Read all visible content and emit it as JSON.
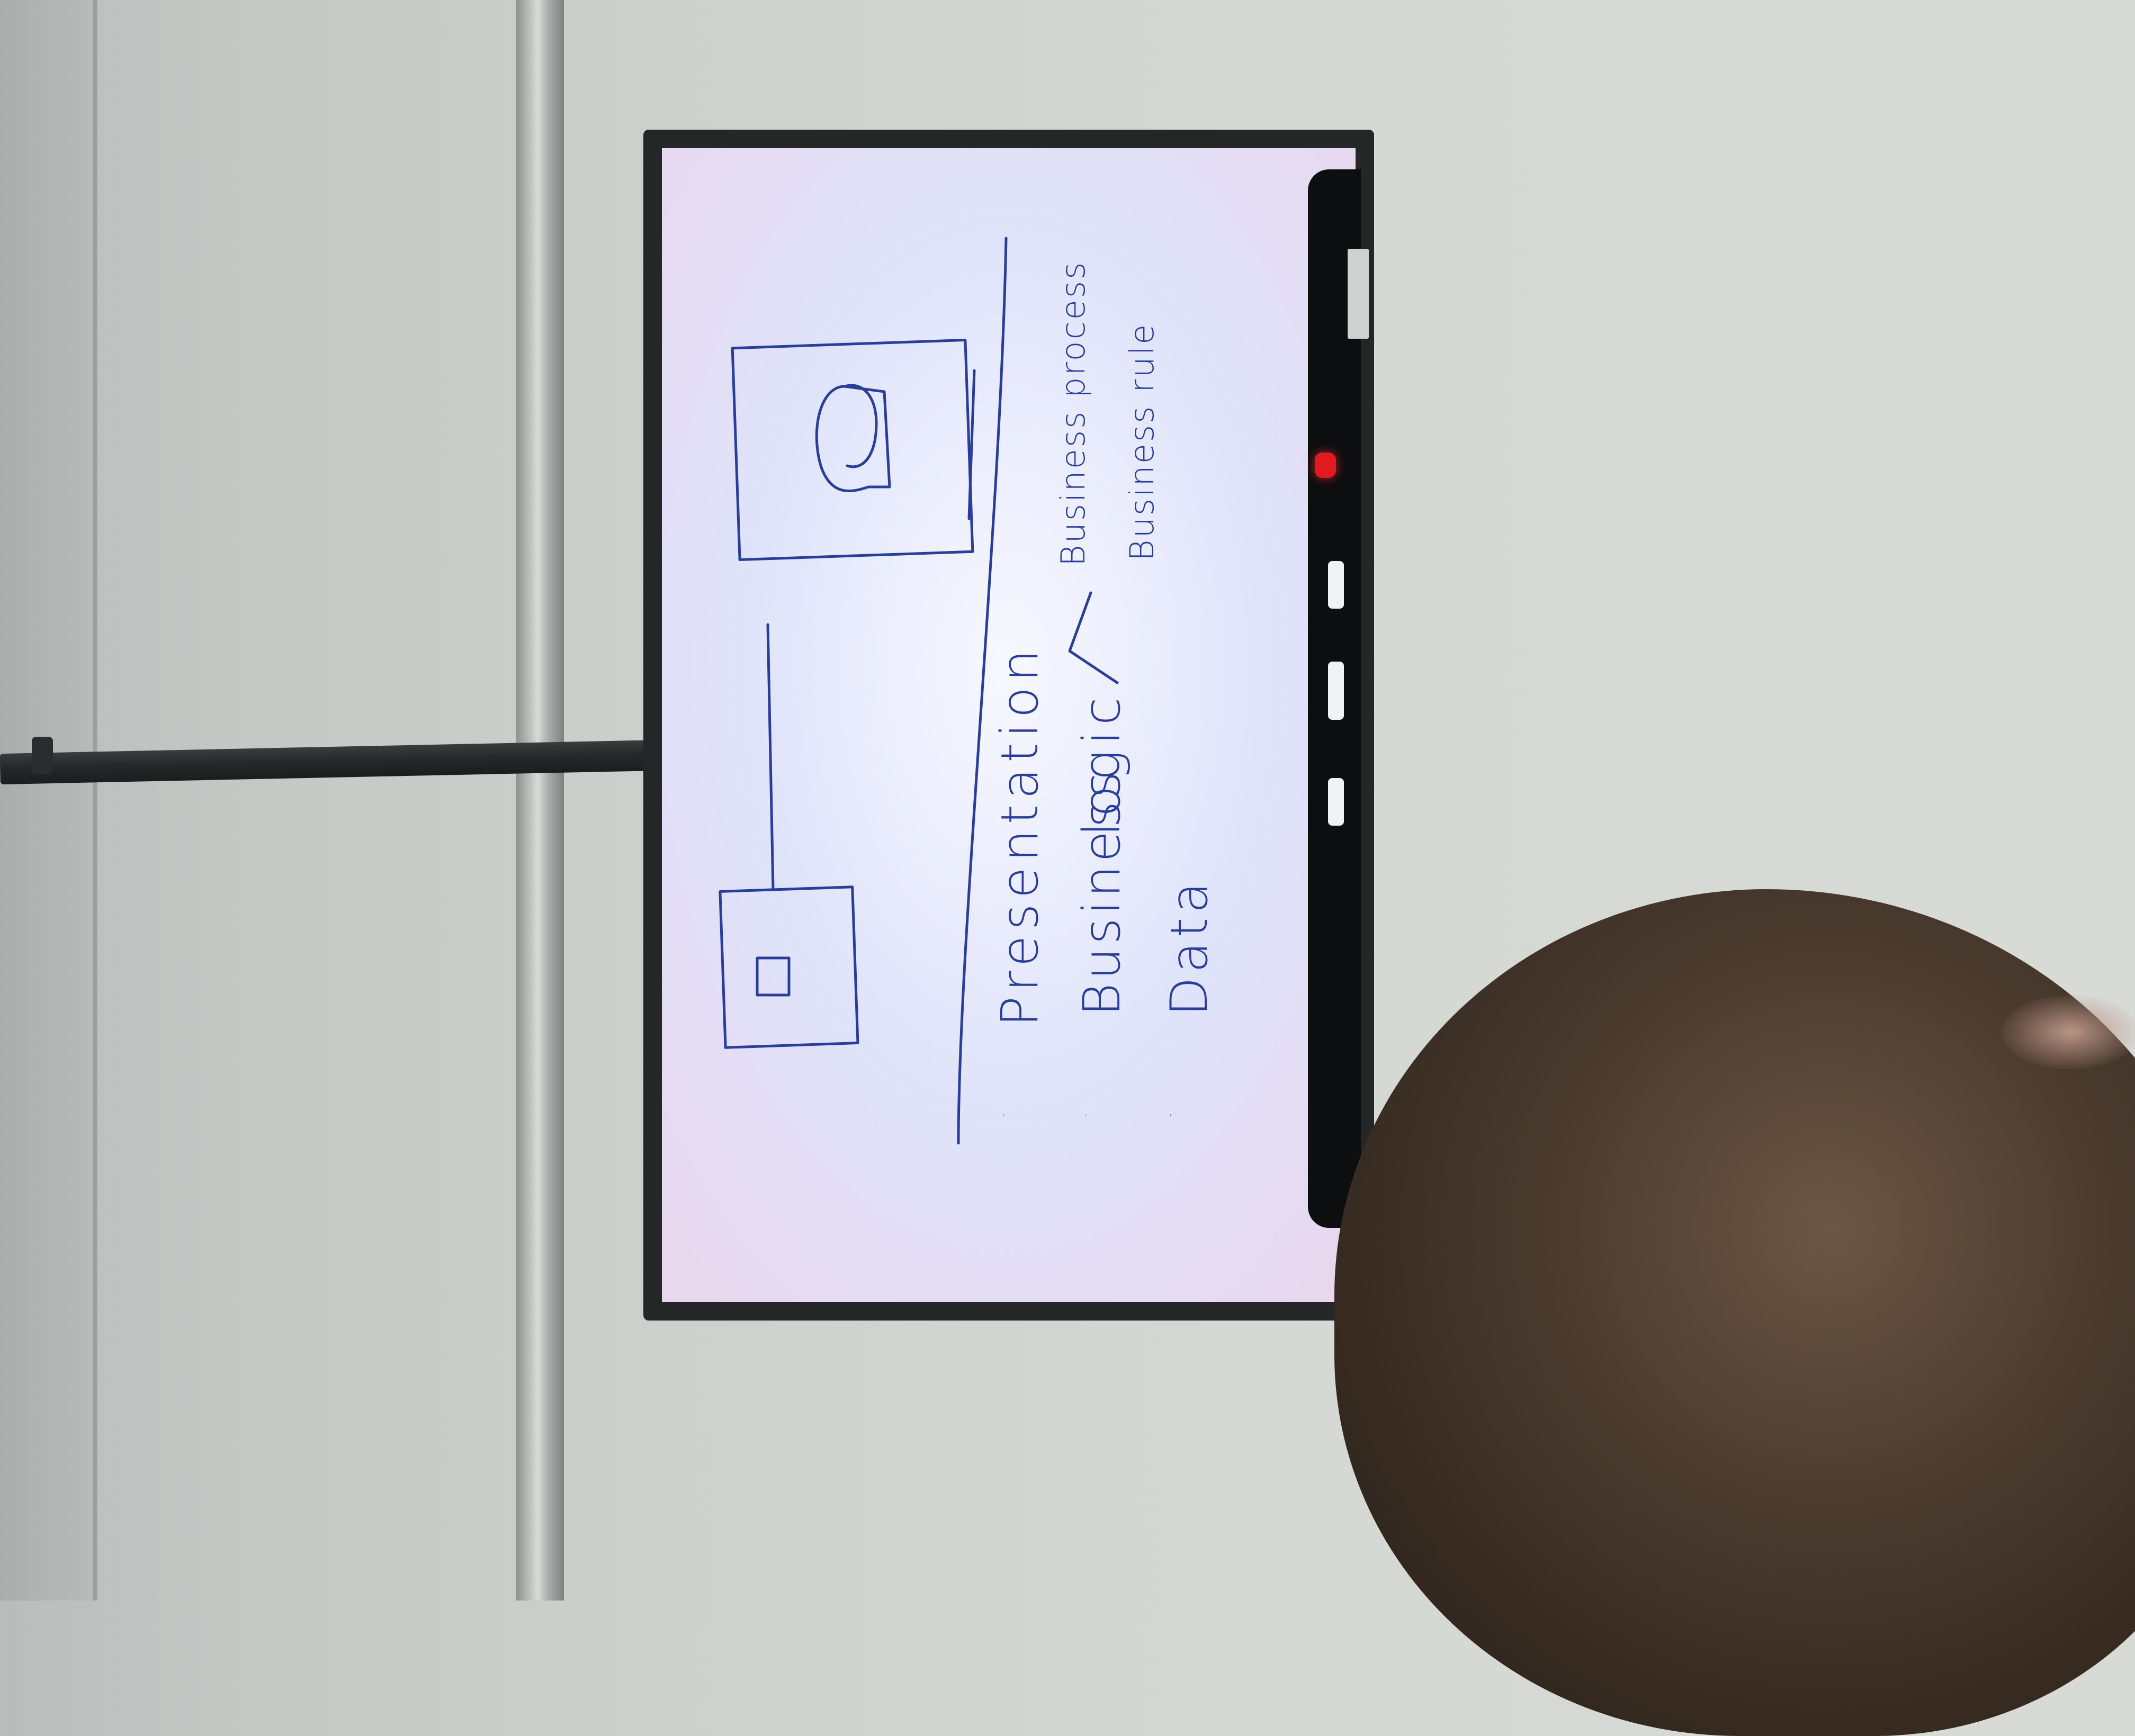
{
  "slide": {
    "items": [
      {
        "bullet": "-",
        "label": "Presentation"
      },
      {
        "bullet": "-",
        "label": "Business",
        "label2": "logic"
      },
      {
        "bullet": "-",
        "label": "Data"
      }
    ],
    "branches": [
      "Business process",
      "Business rule"
    ]
  },
  "colors": {
    "ink": "#2a3d9a",
    "screen_bg": "#eef0fb",
    "bezel": "#242628",
    "record_light": "#e11a1f"
  },
  "icons": [
    "record-indicator-icon"
  ]
}
